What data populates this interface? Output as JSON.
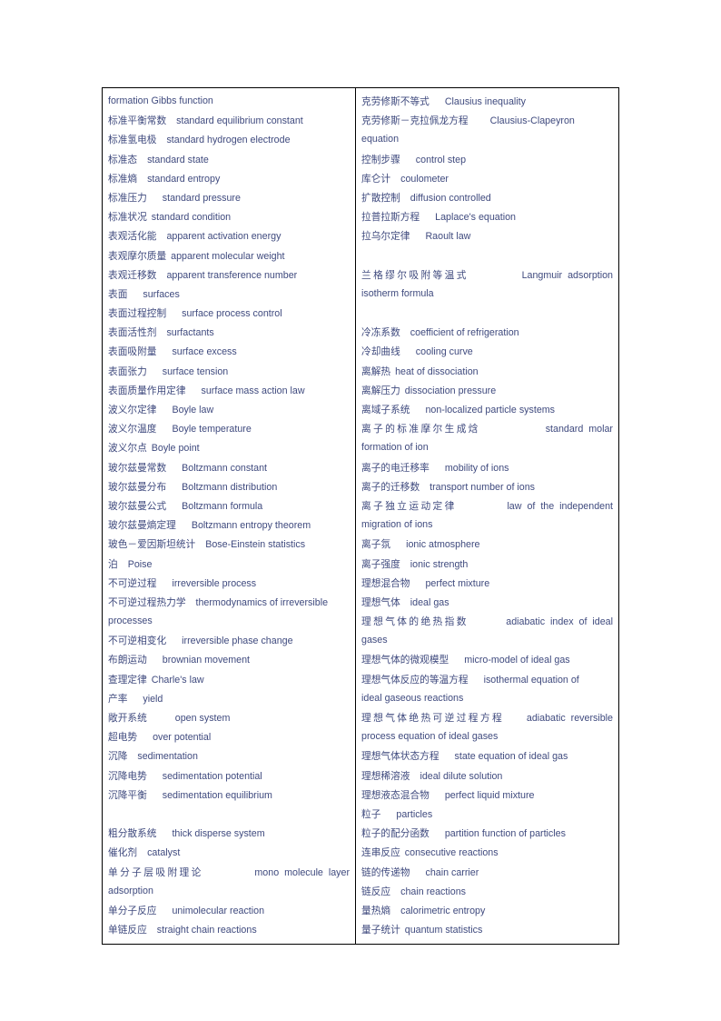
{
  "document": {
    "type": "bilingual-glossary-table",
    "title": "Physical Chemistry Terms Glossary (Chinese-English)",
    "text_color": "#3f4a7e",
    "border_color": "#000000"
  },
  "table": {
    "columns": [
      {
        "id": "left-column",
        "entries": [
          {
            "term": "",
            "english": "formation Gibbs function",
            "gap": 0,
            "continuation": true
          },
          {
            "term": "标准平衡常数",
            "english": "standard equilibrium constant",
            "gap": 2
          },
          {
            "term": "标准氢电极",
            "english": "standard hydrogen electrode",
            "gap": 2
          },
          {
            "term": "标准态",
            "english": "standard state",
            "gap": 2
          },
          {
            "term": "标准熵",
            "english": "standard entropy",
            "gap": 2
          },
          {
            "term": "标准压力",
            "english": "standard pressure",
            "gap": 3
          },
          {
            "term": "标准状况",
            "english": "standard condition",
            "gap": 1
          },
          {
            "term": "表观活化能",
            "english": "apparent activation energy",
            "gap": 2
          },
          {
            "term": "表观摩尔质量",
            "english": "apparent molecular weight",
            "gap": 1
          },
          {
            "term": "表观迁移数",
            "english": "apparent transference number",
            "gap": 2
          },
          {
            "term": "表面",
            "english": "surfaces",
            "gap": 3
          },
          {
            "term": "表面过程控制",
            "english": "surface process control",
            "gap": 3
          },
          {
            "term": "表面活性剂",
            "english": "surfactants",
            "gap": 2
          },
          {
            "term": "表面吸附量",
            "english": "surface excess",
            "gap": 3
          },
          {
            "term": "表面张力",
            "english": "surface tension",
            "gap": 3
          },
          {
            "term": "表面质量作用定律",
            "english": "surface mass action law",
            "gap": 3
          },
          {
            "term": "波义尔定律",
            "english": "Boyle law",
            "gap": 3
          },
          {
            "term": "波义尔温度",
            "english": "Boyle temperature",
            "gap": 3
          },
          {
            "term": "波义尔点",
            "english": "Boyle point",
            "gap": 1
          },
          {
            "term": "玻尔兹曼常数",
            "english": "Boltzmann constant",
            "gap": 3
          },
          {
            "term": "玻尔兹曼分布",
            "english": "Boltzmann distribution",
            "gap": 3
          },
          {
            "term": "玻尔兹曼公式",
            "english": "Boltzmann formula",
            "gap": 3
          },
          {
            "term": "玻尔兹曼熵定理",
            "english": "Boltzmann entropy theorem",
            "gap": 3
          },
          {
            "term": "玻色－爱因斯坦统计",
            "english": "Bose-Einstein statistics",
            "gap": 2
          },
          {
            "term": "泊",
            "english": "Poise",
            "gap": 2
          },
          {
            "term": "不可逆过程",
            "english": "irreversible process",
            "gap": 3
          },
          {
            "term": "不可逆过程热力学",
            "english": "thermodynamics of irreversible",
            "gap": 2,
            "wrap_next": "processes"
          },
          {
            "term": "不可逆相变化",
            "english": "irreversible phase change",
            "gap": 3
          },
          {
            "term": "布朗运动",
            "english": "brownian movement",
            "gap": 3
          },
          {
            "term": "查理定律",
            "english": "Charle's law",
            "gap": 1
          },
          {
            "term": "产率",
            "english": "yield",
            "gap": 3
          },
          {
            "term": "敞开系统",
            "english": "open system",
            "gap": 5
          },
          {
            "term": "超电势",
            "english": "over potential",
            "gap": 3
          },
          {
            "term": "沉降",
            "english": "sedimentation",
            "gap": 2
          },
          {
            "term": "沉降电势",
            "english": "sedimentation potential",
            "gap": 3
          },
          {
            "term": "沉降平衡",
            "english": "sedimentation equilibrium",
            "gap": 3
          },
          {
            "blank": true
          },
          {
            "term": "粗分散系统",
            "english": "thick disperse system",
            "gap": 3
          },
          {
            "term": "催化剂",
            "english": "catalyst",
            "gap": 2
          },
          {
            "term": "单分子层吸附理论",
            "english": "mono molecule layer",
            "gap": 4,
            "justified": true,
            "wrap_next": "adsorption"
          },
          {
            "term": "单分子反应",
            "english": "unimolecular reaction",
            "gap": 3
          },
          {
            "term": "单链反应",
            "english": "straight chain reactions",
            "gap": 2
          }
        ]
      },
      {
        "id": "right-column",
        "entries": [
          {
            "term": "克劳修斯不等式",
            "english": "Clausius inequality",
            "gap": 3
          },
          {
            "term": "克劳修斯－克拉佩龙方程",
            "english": "Clausius-Clapeyron",
            "gap": 4,
            "wrap_next": "equation"
          },
          {
            "term": "控制步骤",
            "english": "control step",
            "gap": 3
          },
          {
            "term": "库仑计",
            "english": "coulometer",
            "gap": 2
          },
          {
            "term": "扩散控制",
            "english": "diffusion controlled",
            "gap": 2
          },
          {
            "term": "拉普拉斯方程",
            "english": "Laplace's equation",
            "gap": 3
          },
          {
            "term": "拉乌尔定律",
            "english": "Raoult law",
            "gap": 3
          },
          {
            "blank": true
          },
          {
            "term": "兰格缪尔吸附等温式",
            "english": "Langmuir adsorption",
            "gap": 4,
            "justified": true,
            "wrap_next": "isotherm formula"
          },
          {
            "blank": true
          },
          {
            "term": "冷冻系数",
            "english": "coefficient of refrigeration",
            "gap": 2
          },
          {
            "term": "冷却曲线",
            "english": "cooling curve",
            "gap": 3
          },
          {
            "term": "离解热",
            "english": "heat of dissociation",
            "gap": 1
          },
          {
            "term": "离解压力",
            "english": "dissociation pressure",
            "gap": 1
          },
          {
            "term": "离域子系统",
            "english": "non-localized particle systems",
            "gap": 3
          },
          {
            "term": "离子的标准摩尔生成焓",
            "english": "standard molar",
            "gap": 4,
            "justified": true,
            "wrap_next": "formation of ion"
          },
          {
            "term": "离子的电迁移率",
            "english": "mobility of ions",
            "gap": 3
          },
          {
            "term": "离子的迁移数",
            "english": "transport number of ions",
            "gap": 2
          },
          {
            "term": "离子独立运动定律",
            "english": "law of the independent",
            "gap": 4,
            "justified": true,
            "wrap_next": "migration of ions"
          },
          {
            "term": "离子氛",
            "english": "ionic atmosphere",
            "gap": 3
          },
          {
            "term": "离子强度",
            "english": "ionic strength",
            "gap": 2
          },
          {
            "term": "理想混合物",
            "english": "perfect mixture",
            "gap": 3
          },
          {
            "term": "理想气体",
            "english": "ideal gas",
            "gap": 2
          },
          {
            "term": "理想气体的绝热指数",
            "english": "adiabatic index of ideal",
            "gap": 3,
            "justified": true,
            "wrap_next": "gases"
          },
          {
            "term": "理想气体的微观模型",
            "english": "micro-model of ideal gas",
            "gap": 3
          },
          {
            "term": "理想气体反应的等温方程",
            "english": "isothermal equation of",
            "gap": 3,
            "wrap_next": "ideal gaseous reactions"
          },
          {
            "term": "理想气体绝热可逆过程方程",
            "english": "adiabatic reversible",
            "gap": 3,
            "justified": true,
            "wrap_next": "process equation of ideal gases"
          },
          {
            "term": "理想气体状态方程",
            "english": "state equation of ideal gas",
            "gap": 3
          },
          {
            "term": "理想稀溶液",
            "english": "ideal dilute solution",
            "gap": 2
          },
          {
            "term": "理想液态混合物",
            "english": "perfect liquid mixture",
            "gap": 3
          },
          {
            "term": "粒子",
            "english": "particles",
            "gap": 3
          },
          {
            "term": "粒子的配分函数",
            "english": "partition function of particles",
            "gap": 3
          },
          {
            "term": "连串反应",
            "english": "consecutive reactions",
            "gap": 1
          },
          {
            "term": "链的传递物",
            "english": "chain carrier",
            "gap": 3
          },
          {
            "term": "链反应",
            "english": "chain reactions",
            "gap": 2
          },
          {
            "term": "量热熵",
            "english": "calorimetric entropy",
            "gap": 2
          },
          {
            "term": "量子统计",
            "english": "quantum statistics",
            "gap": 1
          }
        ]
      }
    ]
  }
}
